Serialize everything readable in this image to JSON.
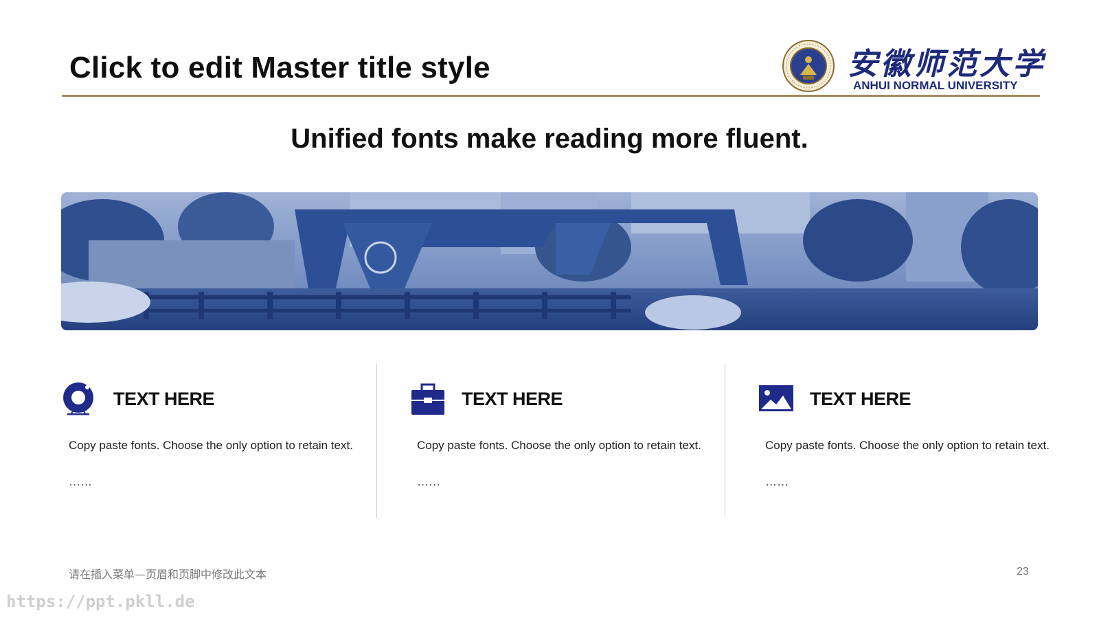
{
  "slide": {
    "title": "Click to edit Master title style",
    "subtitle": "Unified fonts make reading more fluent."
  },
  "logo": {
    "name_cn": "安徽师范大学",
    "name_en": "ANHUI NORMAL UNIVERSITY",
    "seal_text": "ANHUI NORMAL UNIVERSITY",
    "seal_year": "1928"
  },
  "columns": [
    {
      "icon": "camera-icon",
      "heading": "TEXT HERE",
      "body": "Copy paste fonts. Choose the only option to retain text.",
      "ellipsis": "……"
    },
    {
      "icon": "briefcase-icon",
      "heading": "TEXT HERE",
      "body": "Copy paste fonts. Choose the only option to retain text.",
      "ellipsis": "……"
    },
    {
      "icon": "image-icon",
      "heading": "TEXT HERE",
      "body": "Copy paste fonts. Choose the only option to retain text.",
      "ellipsis": "……"
    }
  ],
  "footer": {
    "text": "请在插入菜单—页眉和页脚中修改此文本",
    "page_number": "23"
  },
  "watermark": "https://ppt.pkll.de",
  "colors": {
    "accent_navy": "#1d2a7a",
    "rule_gold": "#a08a5a",
    "banner_tint": "#2e4f93"
  }
}
